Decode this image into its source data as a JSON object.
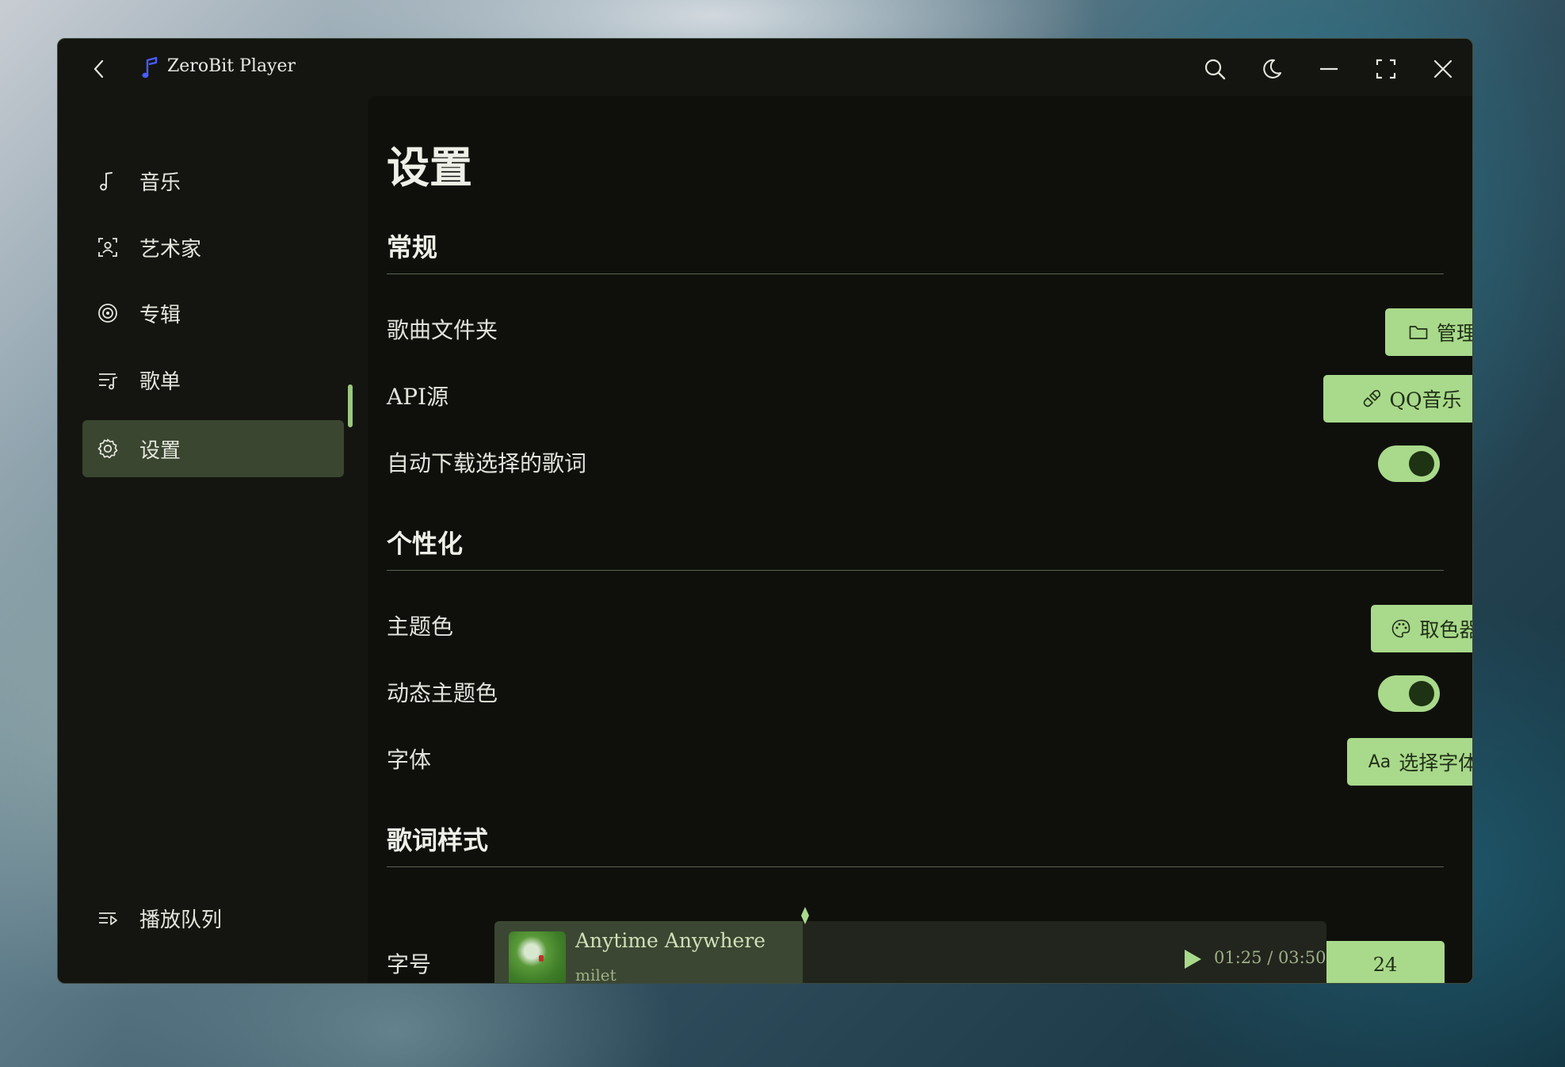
{
  "app": {
    "title": "ZeroBit Player"
  },
  "sidebar": {
    "items": [
      {
        "label": "音乐",
        "icon": "music-note-icon"
      },
      {
        "label": "艺术家",
        "icon": "artist-icon"
      },
      {
        "label": "专辑",
        "icon": "album-icon"
      },
      {
        "label": "歌单",
        "icon": "playlist-icon"
      },
      {
        "label": "设置",
        "icon": "gear-icon",
        "active": true
      }
    ],
    "queue": {
      "label": "播放队列",
      "icon": "queue-icon"
    }
  },
  "page": {
    "title": "设置",
    "sections": {
      "general": {
        "title": "常规",
        "song_folder": {
          "label": "歌曲文件夹",
          "button": "管理"
        },
        "api_source": {
          "label": "API源",
          "button": "QQ音乐"
        },
        "auto_download": {
          "label": "自动下载选择的歌词",
          "enabled": true
        }
      },
      "personalize": {
        "title": "个性化",
        "theme_color": {
          "label": "主题色",
          "button": "取色器"
        },
        "dynamic_theme": {
          "label": "动态主题色",
          "enabled": true
        },
        "font": {
          "label": "字体",
          "button_prefix": "Aa",
          "button": "选择字体"
        }
      },
      "lyrics": {
        "title": "歌词样式",
        "font_size": {
          "label": "字号",
          "value": "24"
        }
      }
    }
  },
  "player": {
    "song": "Anytime Anywhere",
    "artist": "milet",
    "time": "01:25 / 03:50",
    "progress_fraction": 0.37
  },
  "colors": {
    "accent": "#a9d98a",
    "accent_dark": "#1e3313",
    "window_bg": "#141510",
    "content_bg": "#0f100c",
    "logo": "#4a5cff"
  }
}
